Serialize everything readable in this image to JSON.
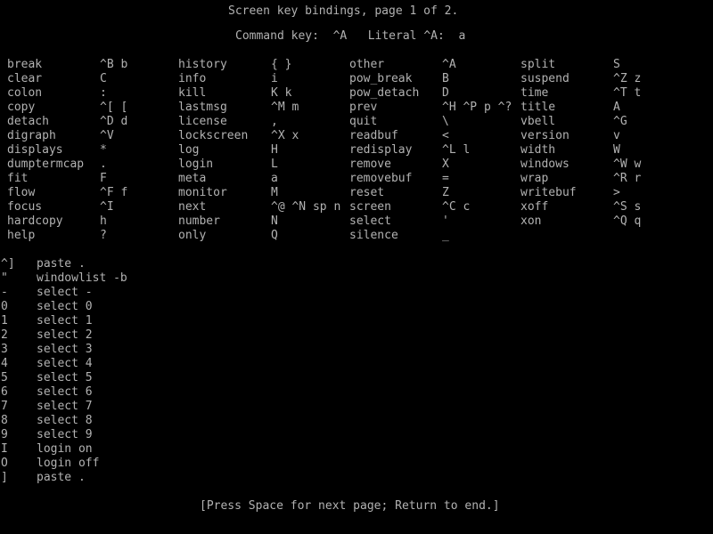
{
  "terminal": {
    "background": "#000000",
    "foreground": "#b2b2b2",
    "char_width": 8,
    "line_height": 16
  },
  "header": {
    "title": "Screen key bindings, page 1 of 2.",
    "command_key_line": "Command key:  ^A   Literal ^A:  a"
  },
  "columns": [
    {
      "entries": [
        {
          "name": "break",
          "keys": "^B b"
        },
        {
          "name": "clear",
          "keys": "C"
        },
        {
          "name": "colon",
          "keys": ":"
        },
        {
          "name": "copy",
          "keys": "^[ ["
        },
        {
          "name": "detach",
          "keys": "^D d"
        },
        {
          "name": "digraph",
          "keys": "^V"
        },
        {
          "name": "displays",
          "keys": "*"
        },
        {
          "name": "dumptermcap",
          "keys": "."
        },
        {
          "name": "fit",
          "keys": "F"
        },
        {
          "name": "flow",
          "keys": "^F f"
        },
        {
          "name": "focus",
          "keys": "^I"
        },
        {
          "name": "hardcopy",
          "keys": "h"
        },
        {
          "name": "help",
          "keys": "?"
        }
      ]
    },
    {
      "entries": [
        {
          "name": "history",
          "keys": "{ }"
        },
        {
          "name": "info",
          "keys": "i"
        },
        {
          "name": "kill",
          "keys": "K k"
        },
        {
          "name": "lastmsg",
          "keys": "^M m"
        },
        {
          "name": "license",
          "keys": ","
        },
        {
          "name": "lockscreen",
          "keys": "^X x"
        },
        {
          "name": "log",
          "keys": "H"
        },
        {
          "name": "login",
          "keys": "L"
        },
        {
          "name": "meta",
          "keys": "a"
        },
        {
          "name": "monitor",
          "keys": "M"
        },
        {
          "name": "next",
          "keys": "^@ ^N sp n"
        },
        {
          "name": "number",
          "keys": "N"
        },
        {
          "name": "only",
          "keys": "Q"
        }
      ]
    },
    {
      "entries": [
        {
          "name": "other",
          "keys": "^A"
        },
        {
          "name": "pow_break",
          "keys": "B"
        },
        {
          "name": "pow_detach",
          "keys": "D"
        },
        {
          "name": "prev",
          "keys": "^H ^P p ^?"
        },
        {
          "name": "quit",
          "keys": "\\"
        },
        {
          "name": "readbuf",
          "keys": "<"
        },
        {
          "name": "redisplay",
          "keys": "^L l"
        },
        {
          "name": "remove",
          "keys": "X"
        },
        {
          "name": "removebuf",
          "keys": "="
        },
        {
          "name": "reset",
          "keys": "Z"
        },
        {
          "name": "screen",
          "keys": "^C c"
        },
        {
          "name": "select",
          "keys": "'"
        },
        {
          "name": "silence",
          "keys": "_"
        }
      ]
    },
    {
      "entries": [
        {
          "name": "split",
          "keys": "S"
        },
        {
          "name": "suspend",
          "keys": "^Z z"
        },
        {
          "name": "time",
          "keys": "^T t"
        },
        {
          "name": "title",
          "keys": "A"
        },
        {
          "name": "vbell",
          "keys": "^G"
        },
        {
          "name": "version",
          "keys": "v"
        },
        {
          "name": "width",
          "keys": "W"
        },
        {
          "name": "windows",
          "keys": "^W w"
        },
        {
          "name": "wrap",
          "keys": "^R r"
        },
        {
          "name": "writebuf",
          "keys": ">"
        },
        {
          "name": "xoff",
          "keys": "^S s"
        },
        {
          "name": "xon",
          "keys": "^Q q"
        }
      ]
    }
  ],
  "bindings": [
    {
      "key": "^]",
      "command": "paste ."
    },
    {
      "key": "\"",
      "command": "windowlist -b"
    },
    {
      "key": "-",
      "command": "select -"
    },
    {
      "key": "0",
      "command": "select 0"
    },
    {
      "key": "1",
      "command": "select 1"
    },
    {
      "key": "2",
      "command": "select 2"
    },
    {
      "key": "3",
      "command": "select 3"
    },
    {
      "key": "4",
      "command": "select 4"
    },
    {
      "key": "5",
      "command": "select 5"
    },
    {
      "key": "6",
      "command": "select 6"
    },
    {
      "key": "7",
      "command": "select 7"
    },
    {
      "key": "8",
      "command": "select 8"
    },
    {
      "key": "9",
      "command": "select 9"
    },
    {
      "key": "I",
      "command": "login on"
    },
    {
      "key": "O",
      "command": "login off"
    },
    {
      "key": "]",
      "command": "paste ."
    }
  ],
  "footer": {
    "prompt": "[Press Space for next page; Return to end.]"
  }
}
